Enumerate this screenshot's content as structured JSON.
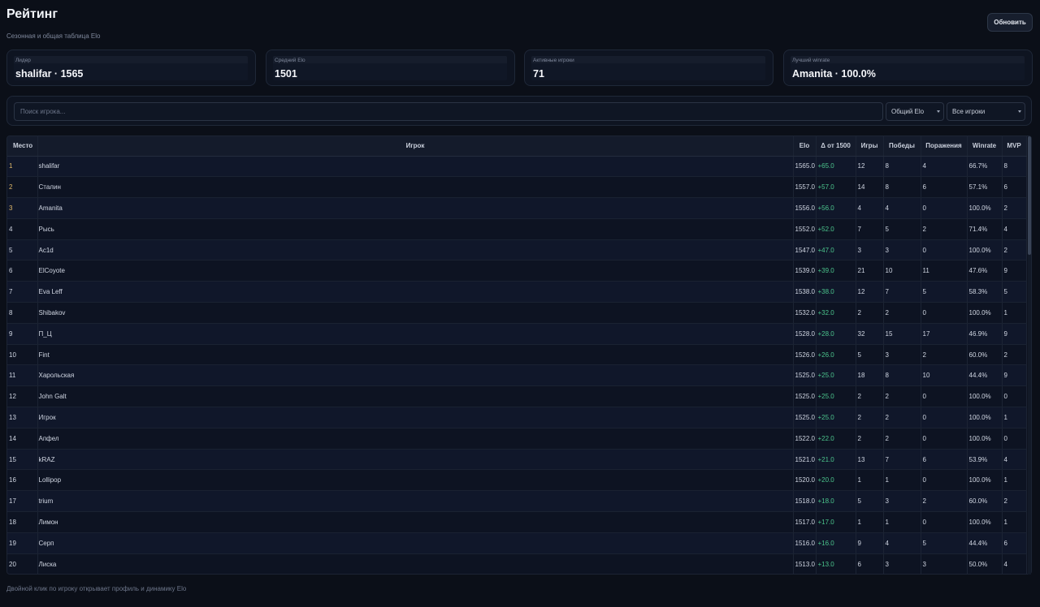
{
  "header": {
    "title": "Рейтинг",
    "subtitle": "Сезонная и общая таблица Elo",
    "refresh_label": "Обновить"
  },
  "stats": [
    {
      "label": "Лидер",
      "value": "shalifar · 1565"
    },
    {
      "label": "Средний Elo",
      "value": "1501"
    },
    {
      "label": "Активные игроки",
      "value": "71"
    },
    {
      "label": "Лучший winrate",
      "value": "Amanita · 100.0%"
    }
  ],
  "filters": {
    "search_placeholder": "Поиск игрока...",
    "elo_mode": "Общий Elo",
    "player_scope": "Все игроки"
  },
  "table": {
    "columns": [
      "Место",
      "Игрок",
      "Elo",
      "Δ от 1500",
      "Игры",
      "Победы",
      "Поражения",
      "Winrate",
      "MVP"
    ],
    "rows": [
      [
        "1",
        "shalifar",
        "1565.0",
        "+65.0",
        "12",
        "8",
        "4",
        "66.7%",
        "8"
      ],
      [
        "2",
        "Сталин",
        "1557.0",
        "+57.0",
        "14",
        "8",
        "6",
        "57.1%",
        "6"
      ],
      [
        "3",
        "Amanita",
        "1556.0",
        "+56.0",
        "4",
        "4",
        "0",
        "100.0%",
        "2"
      ],
      [
        "4",
        "Рысь",
        "1552.0",
        "+52.0",
        "7",
        "5",
        "2",
        "71.4%",
        "4"
      ],
      [
        "5",
        "Ac1d",
        "1547.0",
        "+47.0",
        "3",
        "3",
        "0",
        "100.0%",
        "2"
      ],
      [
        "6",
        "ElCoyote",
        "1539.0",
        "+39.0",
        "21",
        "10",
        "11",
        "47.6%",
        "9"
      ],
      [
        "7",
        "Eva Leff",
        "1538.0",
        "+38.0",
        "12",
        "7",
        "5",
        "58.3%",
        "5"
      ],
      [
        "8",
        "Shibakov",
        "1532.0",
        "+32.0",
        "2",
        "2",
        "0",
        "100.0%",
        "1"
      ],
      [
        "9",
        "П_Ц",
        "1528.0",
        "+28.0",
        "32",
        "15",
        "17",
        "46.9%",
        "9"
      ],
      [
        "10",
        "Fint",
        "1526.0",
        "+26.0",
        "5",
        "3",
        "2",
        "60.0%",
        "2"
      ],
      [
        "11",
        "Харольская",
        "1525.0",
        "+25.0",
        "18",
        "8",
        "10",
        "44.4%",
        "9"
      ],
      [
        "12",
        "John Galt",
        "1525.0",
        "+25.0",
        "2",
        "2",
        "0",
        "100.0%",
        "0"
      ],
      [
        "13",
        "Игрок",
        "1525.0",
        "+25.0",
        "2",
        "2",
        "0",
        "100.0%",
        "1"
      ],
      [
        "14",
        "Апфел",
        "1522.0",
        "+22.0",
        "2",
        "2",
        "0",
        "100.0%",
        "0"
      ],
      [
        "15",
        "kRAZ",
        "1521.0",
        "+21.0",
        "13",
        "7",
        "6",
        "53.9%",
        "4"
      ],
      [
        "16",
        "Lollipop",
        "1520.0",
        "+20.0",
        "1",
        "1",
        "0",
        "100.0%",
        "1"
      ],
      [
        "17",
        "trium",
        "1518.0",
        "+18.0",
        "5",
        "3",
        "2",
        "60.0%",
        "2"
      ],
      [
        "18",
        "Лимон",
        "1517.0",
        "+17.0",
        "1",
        "1",
        "0",
        "100.0%",
        "1"
      ],
      [
        "19",
        "Серп",
        "1516.0",
        "+16.0",
        "9",
        "4",
        "5",
        "44.4%",
        "6"
      ],
      [
        "20",
        "Лиска",
        "1513.0",
        "+13.0",
        "6",
        "3",
        "3",
        "50.0%",
        "4"
      ]
    ]
  },
  "footer": {
    "hint": "Двойной клик по игроку открывает профиль и динамику Elo"
  },
  "colors": {
    "accent_positive": "#4bc48c",
    "podium": "#e0b96a"
  }
}
